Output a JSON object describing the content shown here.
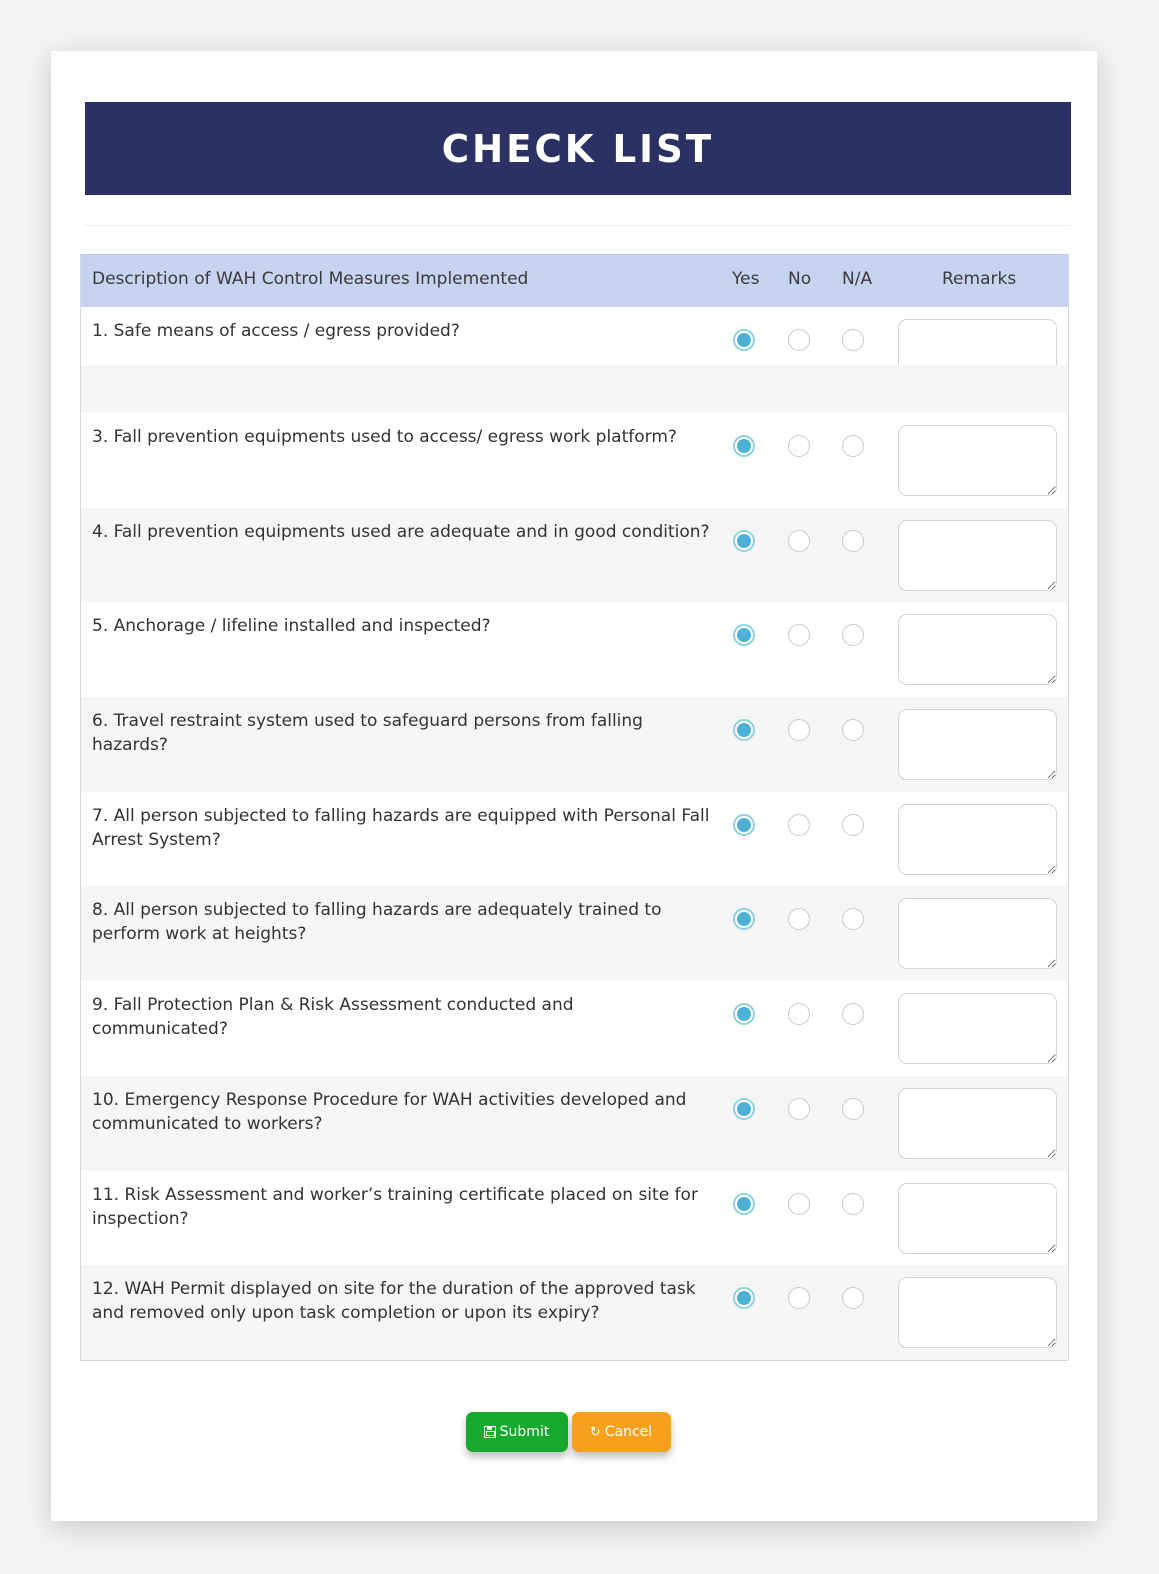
{
  "title": "CHECK LIST",
  "table": {
    "headers": {
      "description": "Description of WAH Control Measures Implemented",
      "yes": "Yes",
      "no": "No",
      "na": "N/A",
      "remarks": "Remarks"
    },
    "rows": [
      {
        "text": "1. Safe means of access / egress provided?",
        "answer": "yes",
        "remarks": ""
      },
      {
        "text": "3. Fall prevention equipments used to access/ egress work platform?",
        "answer": "yes",
        "remarks": ""
      },
      {
        "text": "4. Fall prevention equipments used are adequate and in good condition?",
        "answer": "yes",
        "remarks": ""
      },
      {
        "text": "5. Anchorage / lifeline installed and inspected?",
        "answer": "yes",
        "remarks": ""
      },
      {
        "text": "6. Travel restraint system used to safeguard persons from falling hazards?",
        "answer": "yes",
        "remarks": ""
      },
      {
        "text": "7. All person subjected to falling hazards are equipped with Personal Fall Arrest System?",
        "answer": "yes",
        "remarks": ""
      },
      {
        "text": "8. All person subjected to falling hazards are adequately trained to perform work at heights?",
        "answer": "yes",
        "remarks": ""
      },
      {
        "text": "9. Fall Protection Plan & Risk Assessment conducted and communicated?",
        "answer": "yes",
        "remarks": ""
      },
      {
        "text": "10. Emergency Response Procedure for WAH activities developed and communicated to workers?",
        "answer": "yes",
        "remarks": ""
      },
      {
        "text": "11. Risk Assessment and worker’s training certificate placed on site for inspection?",
        "answer": "yes",
        "remarks": ""
      },
      {
        "text": "12. WAH Permit displayed on site for the duration of the approved task and removed only upon task completion or upon its expiry?",
        "answer": "yes",
        "remarks": ""
      }
    ]
  },
  "buttons": {
    "submit": {
      "label": "Submit",
      "icon": "floppy-disk-icon"
    },
    "cancel": {
      "label": "Cancel",
      "icon": "refresh-icon"
    }
  },
  "colors": {
    "title_bar": "#2b3162",
    "table_header": "#c6d4f1",
    "radio_checked": "#4fb0d6",
    "submit": "#17a82e",
    "cancel": "#f6a01c"
  }
}
